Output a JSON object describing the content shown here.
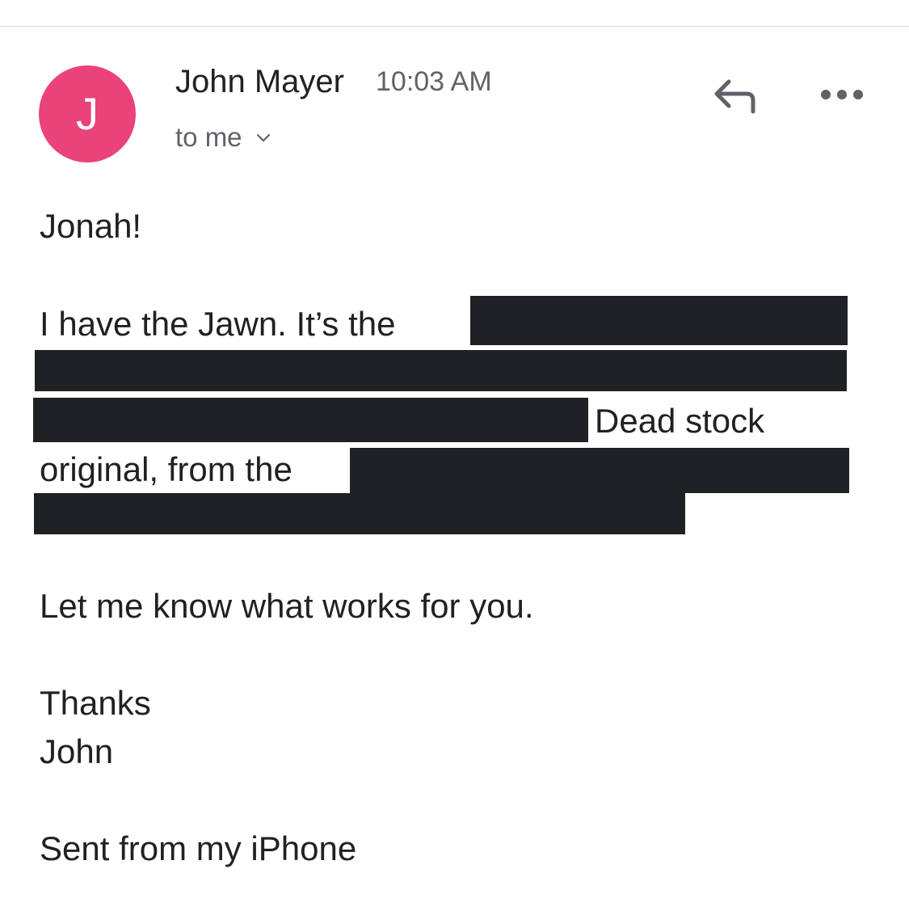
{
  "colors": {
    "avatar_bg": "#ea4379",
    "redaction": "#202124",
    "icon": "#5f6368",
    "divider": "#dadce0"
  },
  "header": {
    "avatar_initial": "J",
    "sender_name": "John Mayer",
    "time": "10:03 AM",
    "recipient": "to me",
    "icons": {
      "expand": "chevron-down-icon",
      "reply": "reply-icon",
      "more": "more-horizontal-icon"
    }
  },
  "message": {
    "greeting": "Jonah!",
    "line1": "I have the Jawn. It’s the",
    "line3": "Dead stock",
    "line4": "original, from the",
    "closing": "Let me know what works for you.",
    "signoff": "Thanks",
    "signature": "John",
    "footer": "Sent from my iPhone"
  }
}
